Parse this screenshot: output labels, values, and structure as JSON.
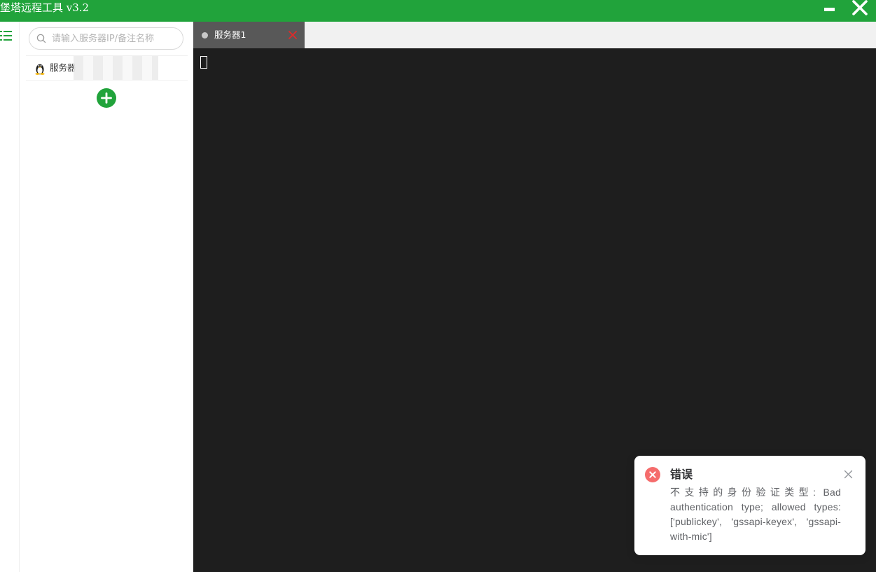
{
  "app": {
    "title": "堡塔远程工具 v3.2"
  },
  "colors": {
    "accent": "#21a33b",
    "terminal_bg": "#1e1e1e",
    "tab_active_bg": "#585858",
    "tab_close": "#e02a2a",
    "error": "#f56c6c"
  },
  "search": {
    "placeholder": "请输入服务器IP/备注名称",
    "value": ""
  },
  "servers": [
    {
      "label": "服务器",
      "os_icon": "linux-tux-icon"
    }
  ],
  "tabs": [
    {
      "label": "服务器1",
      "status": "disconnected"
    }
  ],
  "notification": {
    "type": "error",
    "title": "错误",
    "message": "不支持的身份验证类型: Bad authentication type; allowed types: ['publickey', 'gssapi-keyex', 'gssapi-with-mic']"
  }
}
